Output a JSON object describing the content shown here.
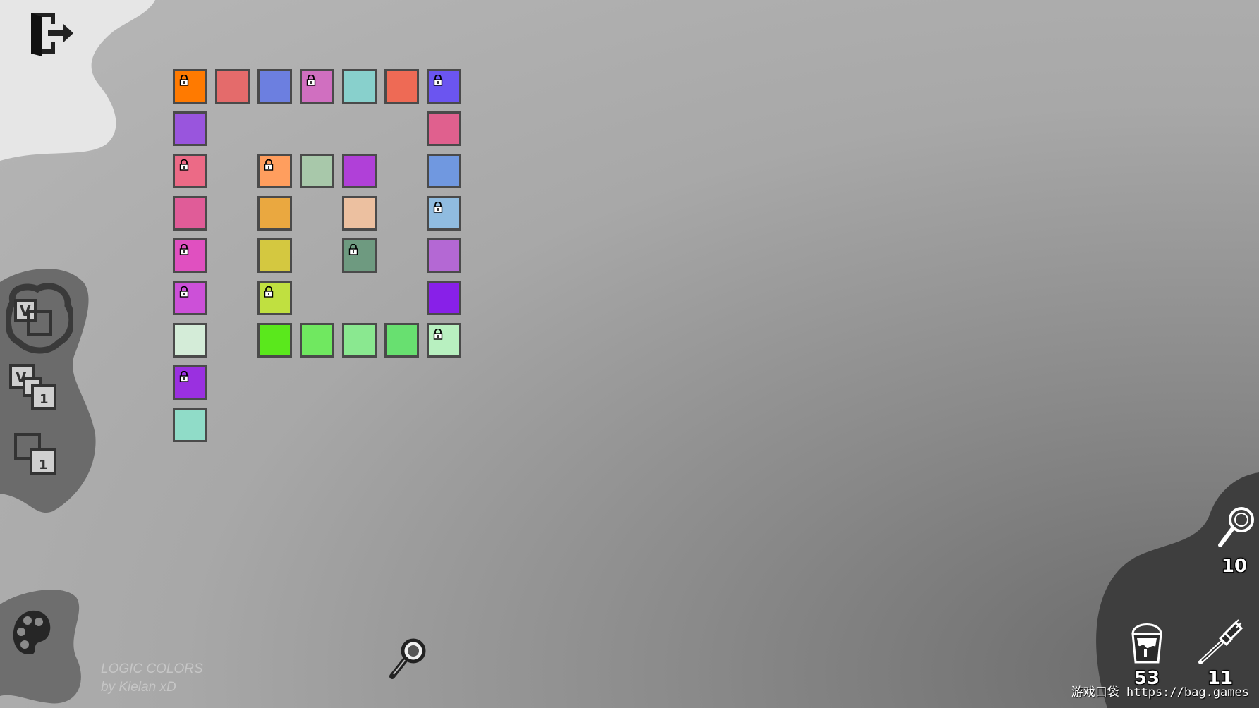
{
  "game": {
    "title_line1": "LOGIC COLORS",
    "title_line2": "by Kielan xD"
  },
  "counters": {
    "hints": "10",
    "buckets": "53",
    "brushes": "11"
  },
  "watermark": "游戏口袋 https://bag.games",
  "icons": {
    "exit": "exit-door-icon",
    "view_all": "view-all-icon",
    "view_single": "view-single-icon",
    "single": "single-layer-icon",
    "palette": "palette-icon",
    "magnifier": "magnifier-icon",
    "hint": "hint-magnifier-icon",
    "bucket": "paint-bucket-icon",
    "brush": "paint-brush-icon"
  },
  "tiles": [
    {
      "col": 0,
      "row": 0,
      "color": "#ff7a00",
      "locked": true
    },
    {
      "col": 1,
      "row": 0,
      "color": "#e46b6b",
      "locked": false
    },
    {
      "col": 2,
      "row": 0,
      "color": "#6c7fe0",
      "locked": false
    },
    {
      "col": 3,
      "row": 0,
      "color": "#d06fc0",
      "locked": true
    },
    {
      "col": 4,
      "row": 0,
      "color": "#88d0cc",
      "locked": false
    },
    {
      "col": 5,
      "row": 0,
      "color": "#ee6a55",
      "locked": false
    },
    {
      "col": 6,
      "row": 0,
      "color": "#6b55f0",
      "locked": true
    },
    {
      "col": 0,
      "row": 1,
      "color": "#9955dd",
      "locked": false
    },
    {
      "col": 6,
      "row": 1,
      "color": "#e0608e",
      "locked": false
    },
    {
      "col": 0,
      "row": 2,
      "color": "#ec6a86",
      "locked": true
    },
    {
      "col": 2,
      "row": 2,
      "color": "#ff9e5e",
      "locked": true
    },
    {
      "col": 3,
      "row": 2,
      "color": "#a8c8aa",
      "locked": false
    },
    {
      "col": 4,
      "row": 2,
      "color": "#b040d8",
      "locked": false
    },
    {
      "col": 6,
      "row": 2,
      "color": "#7098e0",
      "locked": false
    },
    {
      "col": 0,
      "row": 3,
      "color": "#e05c98",
      "locked": false
    },
    {
      "col": 2,
      "row": 3,
      "color": "#eaa840",
      "locked": false
    },
    {
      "col": 4,
      "row": 3,
      "color": "#ecc0a0",
      "locked": false
    },
    {
      "col": 6,
      "row": 3,
      "color": "#90bce0",
      "locked": true
    },
    {
      "col": 0,
      "row": 4,
      "color": "#e050c0",
      "locked": true
    },
    {
      "col": 2,
      "row": 4,
      "color": "#d4c840",
      "locked": false
    },
    {
      "col": 4,
      "row": 4,
      "color": "#6e9a80",
      "locked": true
    },
    {
      "col": 6,
      "row": 4,
      "color": "#b468d4",
      "locked": false
    },
    {
      "col": 0,
      "row": 5,
      "color": "#cc50d8",
      "locked": true
    },
    {
      "col": 2,
      "row": 5,
      "color": "#c0e040",
      "locked": true
    },
    {
      "col": 6,
      "row": 5,
      "color": "#8820e8",
      "locked": false
    },
    {
      "col": 0,
      "row": 6,
      "color": "#d4ecd8",
      "locked": false
    },
    {
      "col": 2,
      "row": 6,
      "color": "#5ae81c",
      "locked": false
    },
    {
      "col": 3,
      "row": 6,
      "color": "#70e860",
      "locked": false
    },
    {
      "col": 4,
      "row": 6,
      "color": "#8ae890",
      "locked": false
    },
    {
      "col": 5,
      "row": 6,
      "color": "#68e070",
      "locked": false
    },
    {
      "col": 6,
      "row": 6,
      "color": "#b8f0c0",
      "locked": true
    },
    {
      "col": 0,
      "row": 7,
      "color": "#9a30e0",
      "locked": true
    },
    {
      "col": 0,
      "row": 8,
      "color": "#90dcc8",
      "locked": false
    }
  ]
}
